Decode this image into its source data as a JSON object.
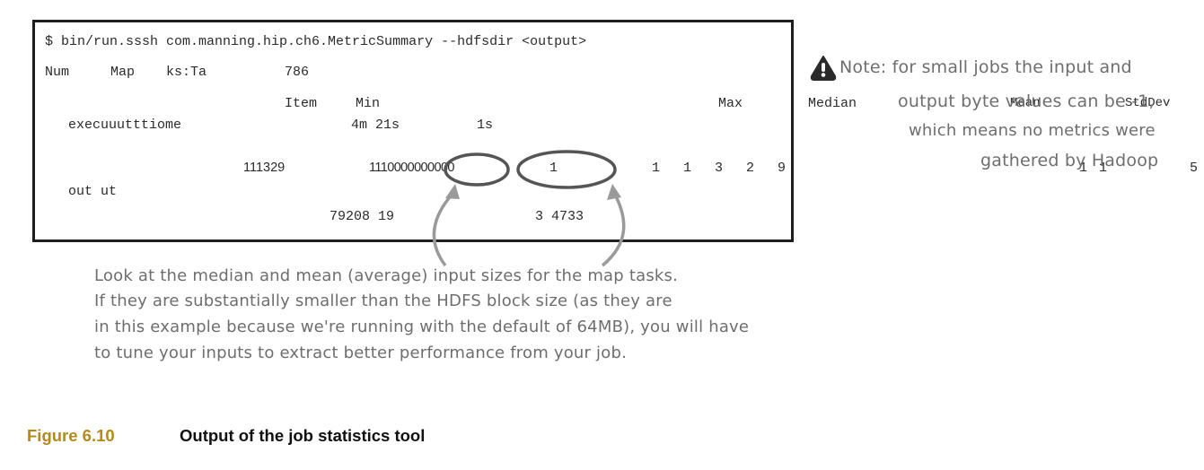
{
  "terminal": {
    "command": "$ bin/run.sssh com.manning.hip.ch6.MetricSummary --hdfsdir <output>",
    "row_num": {
      "a": "Num",
      "b": "Map",
      "c": "ks:Ta",
      "d": "786"
    },
    "headers": {
      "item": "Item",
      "min": "Min",
      "max": "Max",
      "median": "Median",
      "mean": "Mean",
      "stddev": "StdDev"
    },
    "row_exec": {
      "label": "execuuutttiome",
      "min": "4m 21s",
      "value2": "1s"
    },
    "row_input": {
      "v1": "111329",
      "v2": "1110000000000",
      "median": "1",
      "rest": "1  1  3  2  9",
      "right1": "1",
      "right2": "1",
      "right3": "5"
    },
    "row_output": {
      "label": "out ut",
      "v1": "79208 19",
      "v2": "3 4733"
    }
  },
  "note": {
    "icon": "warning-icon",
    "lines": [
      "Note: for small jobs the input and",
      "output byte values can be -1,",
      "which means no metrics were",
      "gathered by Hadoop"
    ]
  },
  "annotation": {
    "lines": [
      "Look at the median and mean (average) input sizes for the map tasks.",
      "If they are substantially smaller than the HDFS block size (as they are",
      "in this example because we're running with the default of 64MB), you will have",
      "to tune your inputs to extract better performance from your job."
    ]
  },
  "caption": {
    "number": "Figure 6.10",
    "text": "Output of the job statistics tool"
  },
  "colors": {
    "caption_accent": "#b38a1f",
    "annotation_gray": "#6e6e6e",
    "border": "#1e1e1e"
  }
}
